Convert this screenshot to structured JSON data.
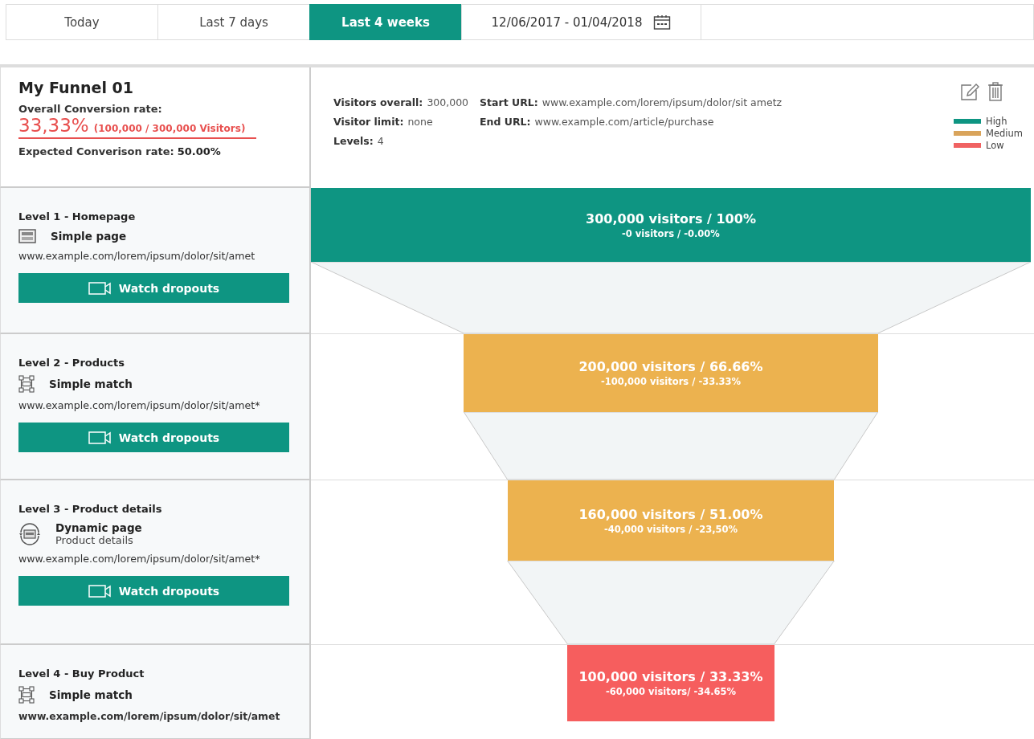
{
  "date_tabs": [
    {
      "label": "Today",
      "selected": false
    },
    {
      "label": "Last 7 days",
      "selected": false
    },
    {
      "label": "Last 4 weeks",
      "selected": true
    }
  ],
  "date_range": {
    "value": "12/06/2017 - 01/04/2018"
  },
  "funnel": {
    "title": "My Funnel 01",
    "overall_label": "Overall Conversion rate:",
    "overall_rate": "33,33%",
    "overall_detail": "(100,000 / 300,000 Visitors)",
    "expected_label": "Expected Converison rate:",
    "expected_value": "50.00%"
  },
  "summary": {
    "column_1": [
      {
        "label": "Visitors overall:",
        "value": "300,000"
      },
      {
        "label": "Visitor limit:",
        "value": "none"
      },
      {
        "label": "Levels:",
        "value": "4"
      }
    ],
    "column_2": [
      {
        "label": "Start URL:",
        "value": "www.example.com/lorem/ipsum/dolor/sit ametz"
      },
      {
        "label": "End URL:",
        "value": "www.example.com/article/purchase"
      }
    ]
  },
  "legend": [
    {
      "label": "High",
      "color": "#0e9582"
    },
    {
      "label": "Medium",
      "color": "#d9a45b"
    },
    {
      "label": "Low",
      "color": "#f06262"
    }
  ],
  "levels": [
    {
      "title": "Level 1 - Homepage",
      "kind": "simple_page",
      "type_label": "Simple page",
      "url": "www.example.com/lorem/ipsum/dolor/sit/amet",
      "emphasized": false,
      "button": "Watch dropouts",
      "stage": {
        "visitors": "300,000 visitors / 100%",
        "dropout": "-0 visitors / -0.00%",
        "color": "#0e9582"
      }
    },
    {
      "title": "Level 2 - Products",
      "kind": "simple_match",
      "type_label": "Simple match",
      "url": "www.example.com/lorem/ipsum/dolor/sit/amet*",
      "emphasized": false,
      "button": "Watch dropouts",
      "stage": {
        "visitors": "200,000 visitors / 66.66%",
        "dropout": "-100,000 visitors / -33.33%",
        "color": "#ecb24f"
      }
    },
    {
      "title": "Level 3 - Product details",
      "kind": "dynamic_page",
      "type_label": "Dynamic page",
      "subtitle": "Product details",
      "url": "www.example.com/lorem/ipsum/dolor/sit/amet*",
      "emphasized": false,
      "button": "Watch dropouts",
      "stage": {
        "visitors": "160,000 visitors / 51.00%",
        "dropout": "-40,000 visitors / -23,50%",
        "color": "#ecb24f"
      }
    },
    {
      "title": "Level 4 - Buy Product",
      "kind": "simple_match",
      "type_label": "Simple match",
      "url": "www.example.com/lorem/ipsum/dolor/sit/amet",
      "emphasized": true,
      "stage": {
        "visitors": "100,000 visitors / 33.33%",
        "dropout": "-60,000 visitors/ -34.65%",
        "color": "#f65e5e"
      }
    }
  ]
}
